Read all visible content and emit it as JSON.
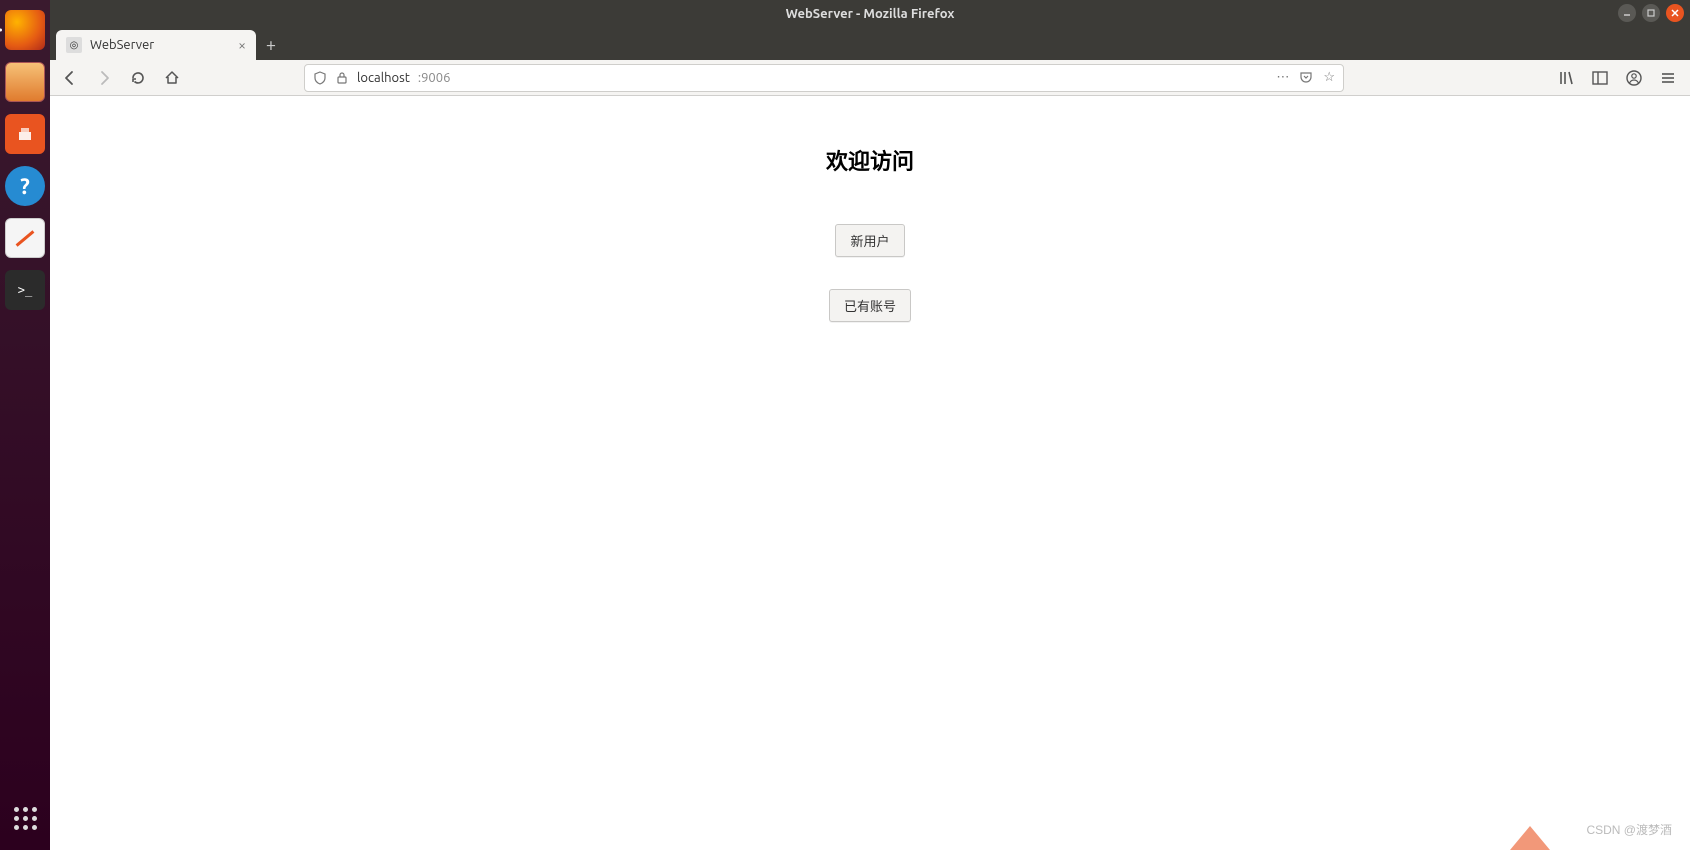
{
  "window": {
    "title": "WebServer - Mozilla Firefox"
  },
  "tab": {
    "title": "WebServer"
  },
  "url": {
    "host": "localhost",
    "port": ":9006"
  },
  "page": {
    "heading": "欢迎访问",
    "button_new_user": "新用户",
    "button_existing": "已有账号"
  },
  "dock": {
    "terminal_prompt": ">_"
  },
  "watermark": "CSDN @渡梦酒"
}
